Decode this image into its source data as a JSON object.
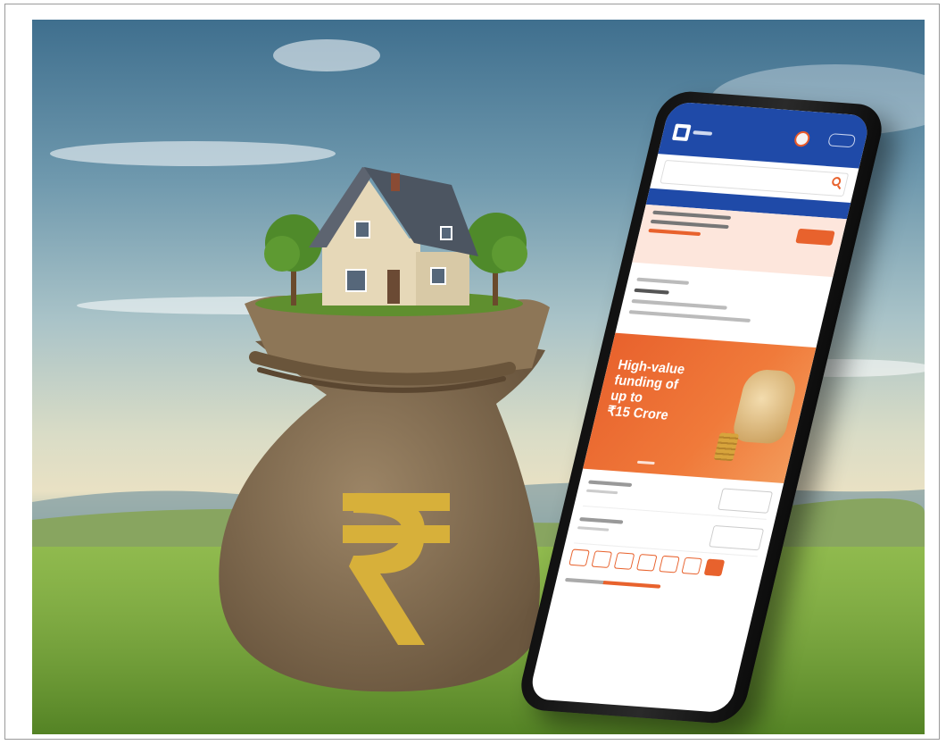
{
  "image": {
    "description_kind": "photo-illustration",
    "colors": {
      "app_blue": "#1f4aa8",
      "brand_orange": "#e8622d",
      "sack": "#8a7458",
      "rupee_gold": "#d7b03a",
      "grass": "#7fae3c"
    }
  },
  "phone_screen": {
    "banner": {
      "headline": "High-value\nfunding of\nup to\n₹15 Crore"
    }
  },
  "icons": {
    "rupee": "rupee-symbol",
    "search": "search-icon",
    "user": "user-icon"
  }
}
